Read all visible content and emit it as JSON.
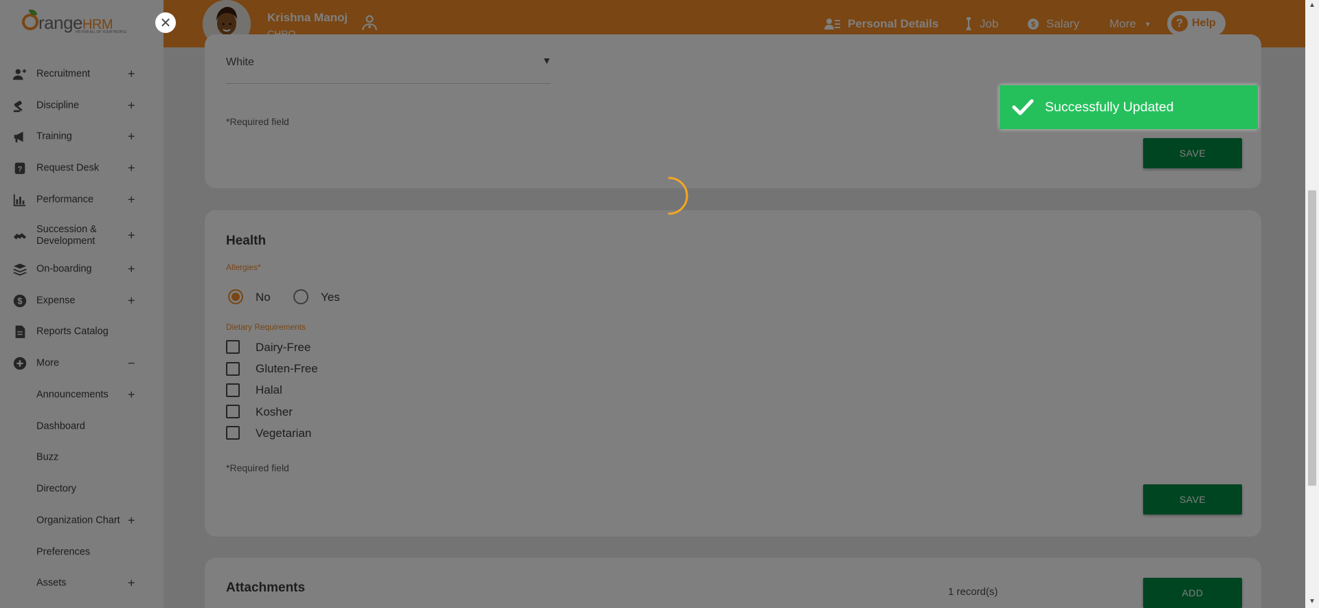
{
  "topbar": {
    "user_name": "Krishna Manoj",
    "user_role": "CHRO",
    "tabs": [
      {
        "label": "Personal Details",
        "icon": "id-card-icon",
        "active": true
      },
      {
        "label": "Job",
        "icon": "briefcase-icon",
        "active": false
      },
      {
        "label": "Salary",
        "icon": "money-icon",
        "active": false
      },
      {
        "label": "More",
        "icon": "chevron-down-icon",
        "active": false
      }
    ],
    "help_label": "Help"
  },
  "sidebar": {
    "logo_text": "range",
    "logo_hrm": "HRM",
    "logo_tagline": "HR FOR ALL OF YOUR PEOPLE",
    "items": [
      {
        "label": "Recruitment",
        "icon": "user-plus-icon",
        "expand": "+"
      },
      {
        "label": "Discipline",
        "icon": "gavel-icon",
        "expand": "+"
      },
      {
        "label": "Training",
        "icon": "megaphone-icon",
        "expand": "+"
      },
      {
        "label": "Request Desk",
        "icon": "question-icon",
        "expand": "+"
      },
      {
        "label": "Performance",
        "icon": "bar-chart-icon",
        "expand": "+"
      },
      {
        "label": "Succession & Development",
        "icon": "handshake-icon",
        "expand": "+"
      },
      {
        "label": "On-boarding",
        "icon": "layers-icon",
        "expand": "+"
      },
      {
        "label": "Expense",
        "icon": "dollar-icon",
        "expand": "+"
      },
      {
        "label": "Reports Catalog",
        "icon": "file-icon",
        "expand": ""
      },
      {
        "label": "More",
        "icon": "plus-circle-icon",
        "expand": "−"
      }
    ],
    "sub_items": [
      {
        "label": "Announcements",
        "expand": "+"
      },
      {
        "label": "Dashboard",
        "expand": ""
      },
      {
        "label": "Buzz",
        "expand": ""
      },
      {
        "label": "Directory",
        "expand": ""
      },
      {
        "label": "Organization Chart",
        "expand": "+"
      },
      {
        "label": "Preferences",
        "expand": ""
      },
      {
        "label": "Assets",
        "expand": "+"
      }
    ]
  },
  "race_section": {
    "selected_value": "White",
    "required_note": "Required field",
    "save_label": "SAVE"
  },
  "health": {
    "title": "Health",
    "allergies_label": "Allergies",
    "allergies_options": [
      {
        "label": "No",
        "checked": true
      },
      {
        "label": "Yes",
        "checked": false
      }
    ],
    "dietary_label": "Dietary Requirements",
    "dietary_options": [
      "Dairy-Free",
      "Gluten-Free",
      "Halal",
      "Kosher",
      "Vegetarian"
    ],
    "required_note": "Required field",
    "save_label": "SAVE"
  },
  "attachments": {
    "title": "Attachments",
    "records": "1 record(s)",
    "add_label": "ADD"
  },
  "toast": {
    "message": "Successfully Updated"
  },
  "colors": {
    "brand": "#f28c28",
    "button": "#008b45",
    "toast": "#25c05c"
  }
}
